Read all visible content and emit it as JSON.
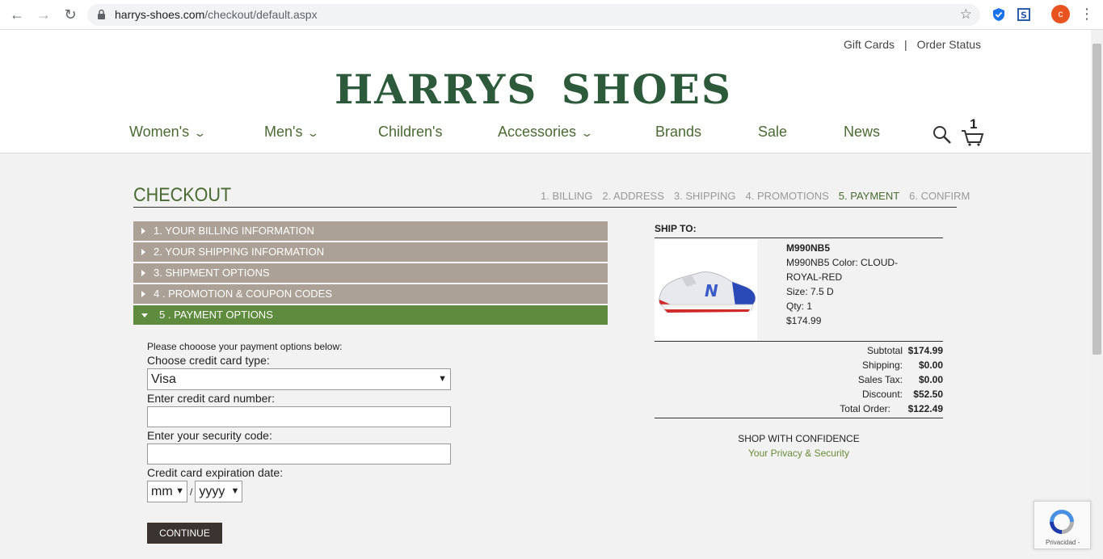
{
  "browser": {
    "url_host": "harrys-shoes.com",
    "url_path": "/checkout/default.aspx",
    "avatar_letter": "c"
  },
  "header": {
    "toplinks": [
      "Gift Cards",
      "Order Status"
    ],
    "toplinks_sep": "|",
    "logo": "HARRYS SHOES",
    "nav": [
      {
        "label": "Women's",
        "dropdown": true
      },
      {
        "label": "Men's",
        "dropdown": true
      },
      {
        "label": "Children's",
        "dropdown": false
      },
      {
        "label": "Accessories",
        "dropdown": true
      },
      {
        "label": "Brands",
        "dropdown": false
      },
      {
        "label": "Sale",
        "dropdown": false
      },
      {
        "label": "News",
        "dropdown": false
      }
    ],
    "cart_count": "1"
  },
  "checkout": {
    "title": "CHECKOUT",
    "steps": [
      "1. BILLING",
      "2. ADDRESS",
      "3. SHIPPING",
      "4. PROMOTIONS",
      "5. PAYMENT",
      "6. CONFIRM"
    ],
    "active_step": "5. PAYMENT",
    "sections": [
      "1. YOUR BILLING INFORMATION",
      "2. YOUR SHIPPING INFORMATION",
      "3. SHIPMENT OPTIONS",
      "4 . PROMOTION & COUPON CODES",
      "5 . PAYMENT OPTIONS"
    ]
  },
  "payment": {
    "note": "Please chooose your payment options below:",
    "card_type_label": "Choose credit card type:",
    "card_type_value": "Visa",
    "card_number_label": "Enter credit card number:",
    "card_number_value": "",
    "security_label": "Enter your security code:",
    "security_value": "",
    "expiry_label": "Credit card expiration date:",
    "expiry_month": "mm",
    "expiry_year": "yyyy",
    "expiry_sep": "/",
    "continue_label": "CONTINUE"
  },
  "ship_to": {
    "heading": "SHIP TO:",
    "product": {
      "sku": "M990NB5",
      "line1": "M990NB5 Color: CLOUD-",
      "line2": "ROYAL-RED",
      "size": "Size: 7.5 D",
      "qty": "Qty: 1",
      "price": "$174.99"
    },
    "totals": [
      {
        "label": "Subtotal",
        "value": "$174.99"
      },
      {
        "label": "Shipping:",
        "value": "$0.00"
      },
      {
        "label": "Sales Tax:",
        "value": "$0.00"
      },
      {
        "label": "Discount:",
        "value": "$52.50"
      },
      {
        "label": "Total Order:",
        "value": "$122.49"
      }
    ],
    "confidence_title": "SHOP WITH CONFIDENCE",
    "confidence_link": "Your Privacy & Security"
  },
  "recaptcha": {
    "text": "Privacidad -"
  }
}
